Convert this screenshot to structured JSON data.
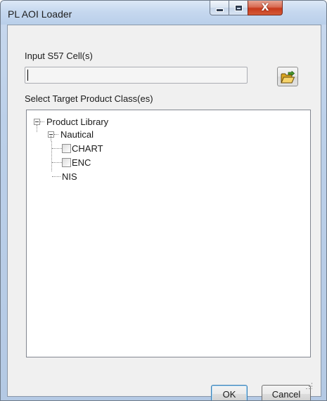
{
  "window": {
    "title": "PL AOI Loader",
    "close_glyph": "X"
  },
  "form": {
    "input_label": "Input S57 Cell(s)",
    "input_value": "",
    "browse_icon": "folder-open-icon",
    "target_label": "Select Target Product Class(es)"
  },
  "tree": {
    "root": "Product Library",
    "child": "Nautical",
    "items": [
      {
        "label": "CHART",
        "checked": false
      },
      {
        "label": "ENC",
        "checked": false
      }
    ],
    "sibling": "NIS"
  },
  "buttons": {
    "ok": "OK",
    "cancel": "Cancel"
  },
  "colors": {
    "titlebar": "#c6d8ef",
    "close_button": "#c7391c",
    "client": "#f0f0f0"
  }
}
